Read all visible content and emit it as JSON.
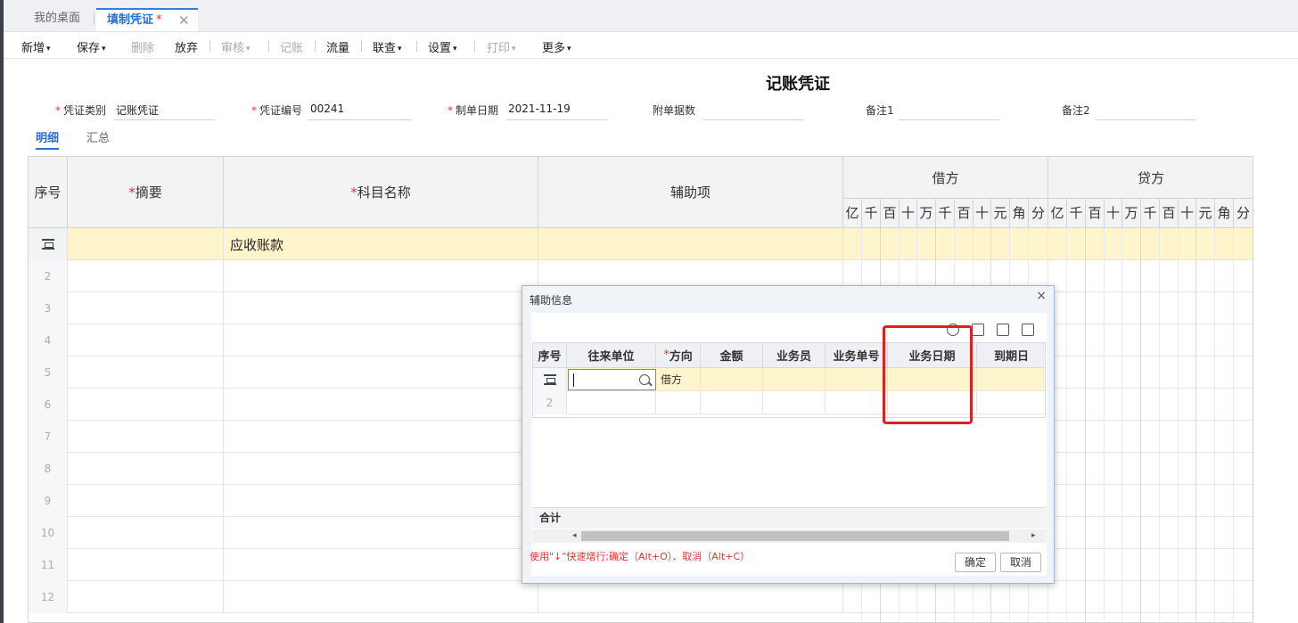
{
  "tabs": [
    {
      "label": "我的桌面"
    },
    {
      "label": "填制凭证",
      "modified": "*",
      "close": "✕"
    }
  ],
  "toolbar": {
    "new": "新增",
    "save": "保存",
    "delete": "删除",
    "abandon": "放弃",
    "audit": "审核",
    "post": "记账",
    "flow": "流量",
    "query": "联查",
    "settings": "设置",
    "print": "打印",
    "more": "更多",
    "caret": "▾"
  },
  "document": {
    "title": "记账凭证",
    "fields": {
      "voucher_type_label": "凭证类别",
      "voucher_type_value": "记账凭证",
      "voucher_no_label": "凭证编号",
      "voucher_no_value": "00241",
      "date_label": "制单日期",
      "date_value": "2021-11-19",
      "attachments_label": "附单据数",
      "attachments_value": "",
      "note1_label": "备注1",
      "note1_value": "",
      "note2_label": "备注2",
      "note2_value": "",
      "required_mark": "*"
    },
    "subtabs": {
      "detail": "明细",
      "summary": "汇总"
    }
  },
  "grid": {
    "headers": {
      "seq": "序号",
      "summary": "摘要",
      "subject": "科目名称",
      "aux": "辅助项",
      "debit": "借方",
      "credit": "贷方"
    },
    "digits": [
      "亿",
      "千",
      "百",
      "十",
      "万",
      "千",
      "百",
      "十",
      "元",
      "角",
      "分"
    ],
    "row1_subject": "应收账款",
    "row_numbers": [
      "2",
      "3",
      "4",
      "5",
      "6",
      "7",
      "8",
      "9",
      "10",
      "11",
      "12"
    ]
  },
  "modal": {
    "title": "辅助信息",
    "close": "×",
    "headers": {
      "seq": "序号",
      "partner": "往来单位",
      "direction": "方向",
      "amount": "金额",
      "salesman": "业务员",
      "bizno": "业务单号",
      "bizdate": "业务日期",
      "duedate": "到期日"
    },
    "row1_direction": "借方",
    "row2_number": "2",
    "total_label": "合计",
    "scroll_left": "◂",
    "scroll_right": "▸",
    "hint": "使用\"↓\"快速增行;确定（Alt+O）、取消（Alt+C）",
    "ok": "确定",
    "cancel": "取消"
  },
  "colors": {
    "accent": "#2a6fd6",
    "required": "#e33333",
    "active_row": "#fff5cc",
    "highlight": "#e02020"
  }
}
